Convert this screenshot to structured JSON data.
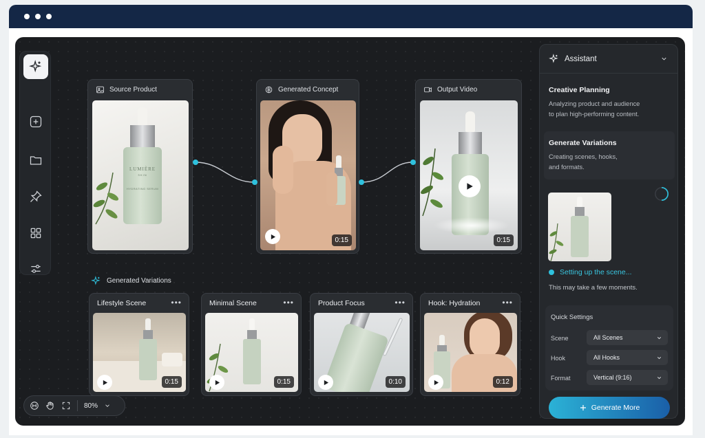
{
  "colors": {
    "accent": "#2fc1dd",
    "browser_bar": "#142746",
    "canvas_bg": "#1b1d20",
    "card_bg": "#2a2d31",
    "generate_gradient_start": "#2bb2d6",
    "generate_gradient_end": "#1a5fa8"
  },
  "rail": {
    "items": [
      {
        "icon": "sparkle-icon",
        "active": true
      },
      {
        "icon": "plus-icon",
        "active": false
      },
      {
        "icon": "folder-icon",
        "active": false
      },
      {
        "icon": "pin-icon",
        "active": false
      },
      {
        "icon": "grid-icon",
        "active": false
      },
      {
        "icon": "sliders-icon",
        "active": false
      }
    ]
  },
  "nodes": {
    "source": {
      "title": "Source Product",
      "icon": "image-icon",
      "brand": "LUMIÈRE",
      "brand_sub": "SKIN",
      "product": "HYDRATING SERUM"
    },
    "concept": {
      "title": "Generated Concept",
      "icon": "brain-icon",
      "duration": "0:15"
    },
    "output": {
      "title": "Output Video",
      "icon": "video-icon",
      "duration": "0:15"
    }
  },
  "variations": {
    "title": "Generated Variations",
    "items": [
      {
        "title": "Lifestyle Scene",
        "duration": "0:15"
      },
      {
        "title": "Minimal Scene",
        "duration": "0:15"
      },
      {
        "title": "Product Focus",
        "duration": "0:10"
      },
      {
        "title": "Hook: Hydration",
        "duration": "0:12"
      }
    ],
    "more_label": "•••"
  },
  "zoom": {
    "value": "80%"
  },
  "assistant": {
    "title": "Assistant",
    "tasks": [
      {
        "title": "Creative Planning",
        "desc_line1": "Analyzing product and audience",
        "desc_line2": "to plan high-performing content.",
        "state": "done"
      },
      {
        "title": "Generate Variations",
        "desc_line1": "Creating scenes, hooks,",
        "desc_line2": "and formats.",
        "state": "in-progress"
      }
    ],
    "status": "Setting up the scene...",
    "status_sub": "This may take a few moments.",
    "quick_settings": {
      "title": "Quick Settings",
      "rows": [
        {
          "label": "Scene",
          "value": "All Scenes"
        },
        {
          "label": "Hook",
          "value": "All Hooks"
        },
        {
          "label": "Format",
          "value": "Vertical (9:16)"
        }
      ]
    },
    "generate_label": "Generate More"
  }
}
